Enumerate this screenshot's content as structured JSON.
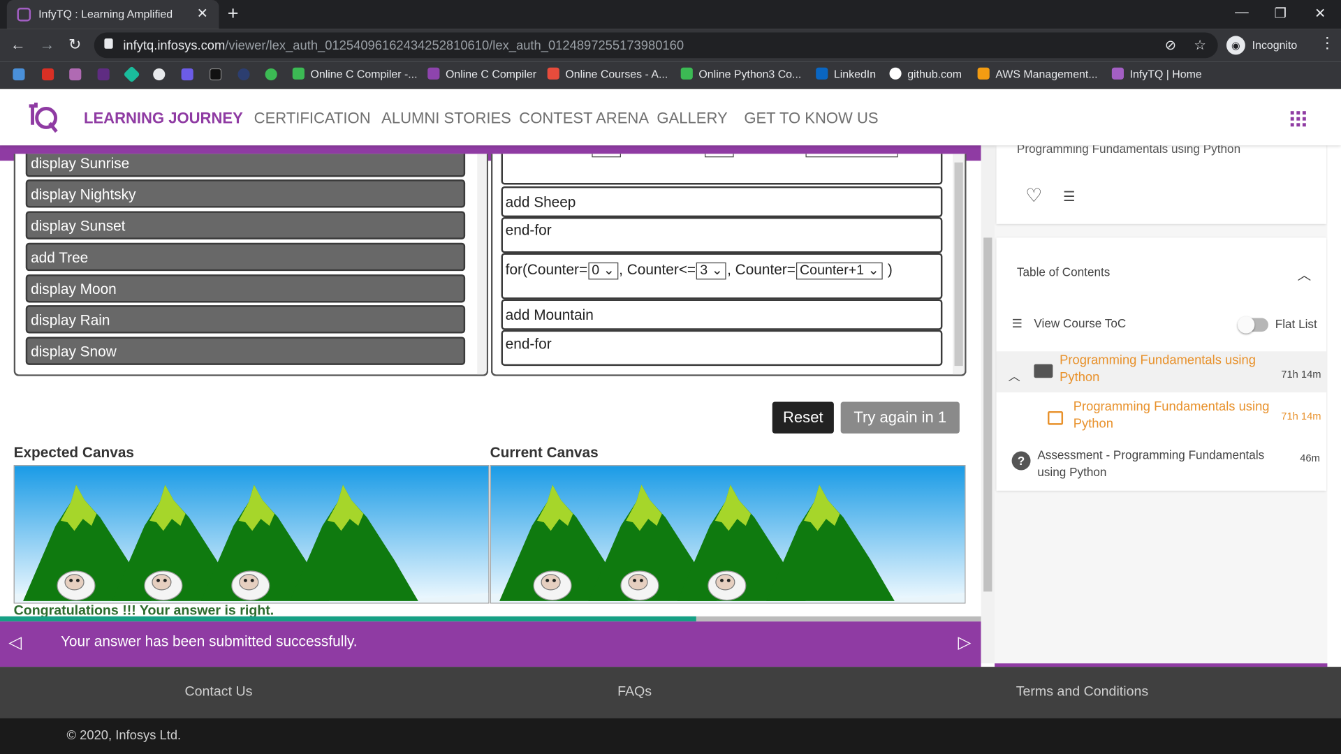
{
  "browser": {
    "tab_title": "InfyTQ : Learning Amplified",
    "tab_close": "✕",
    "new_tab": "+",
    "window_controls": {
      "minimize": "—",
      "restore": "❐",
      "close": "✕"
    },
    "nav": {
      "back": "←",
      "forward": "→",
      "reload": "↻"
    },
    "url_host": "infytq.infosys.com",
    "url_path": "/viewer/lex_auth_01254096162434252810610/lex_auth_0124897255173980160",
    "profile_label": "Incognito",
    "menu": "⋮",
    "omnibox_icons": {
      "eye_off": "⊘",
      "star": "☆"
    },
    "bookmarks": [
      {
        "label": "Online C Compiler -...",
        "color": "#3cba54"
      },
      {
        "label": "Online C Compiler",
        "color": "#8e44ad"
      },
      {
        "label": "Online Courses - A...",
        "color": "#e74c3c"
      },
      {
        "label": "Online Python3 Co...",
        "color": "#3cba54"
      },
      {
        "label": "LinkedIn",
        "color": "#0a66c2"
      },
      {
        "label": "github.com",
        "color": "#ffffff"
      },
      {
        "label": "AWS Management...",
        "color": "#f39c12"
      },
      {
        "label": "InfyTQ | Home",
        "color": "#a35fc4"
      }
    ]
  },
  "header": {
    "nav": [
      {
        "label": "LEARNING JOURNEY",
        "active": true
      },
      {
        "label": "CERTIFICATION",
        "active": false
      },
      {
        "label": "ALUMNI STORIES",
        "active": false
      },
      {
        "label": "CONTEST ARENA",
        "active": false
      },
      {
        "label": "GALLERY",
        "active": false
      },
      {
        "label": "GET TO KNOW US",
        "active": false
      }
    ]
  },
  "commands": [
    "display Sunrise",
    "display Nightsky",
    "display Sunset",
    "add Tree",
    "display Moon",
    "display Rain",
    "display Snow"
  ],
  "code": {
    "line_add_sheep": "add Sheep",
    "line_endfor_1": "end-for",
    "for_prefix": "for(Counter=",
    "for_start": "0",
    "for_mid": ", Counter<=",
    "for_end": "3",
    "for_mid2": ", Counter=",
    "for_step": "Counter+1",
    "for_suffix": " )",
    "line_add_mountain": "add Mountain",
    "line_endfor_2": "end-for",
    "select_arrow": "⌄"
  },
  "buttons": {
    "reset": "Reset",
    "try_again": "Try again in 1"
  },
  "canvas": {
    "expected_title": "Expected Canvas",
    "current_title": "Current Canvas",
    "mountain_count": 4,
    "sheep_count": 3,
    "colors": {
      "sky_top": "#1a9be6",
      "sky_bottom": "#f4fbff",
      "mountain": "#0f7a0f",
      "snowcap": "#a6d62a"
    }
  },
  "feedback": {
    "congrats": "Congratulations !!! Your answer is right.",
    "progress_percent": 71,
    "banner_message": "Your answer has been submitted successfully.",
    "arrow_left": "◁",
    "arrow_right": "▷"
  },
  "sidebar": {
    "course_title": "Programming Fundamentals using Python",
    "toc_title": "Table of Contents",
    "view_toc": "View Course ToC",
    "flat_list": "Flat List",
    "toc_items": [
      {
        "title": "Programming Fundamentals using Python",
        "time": "71h 14m"
      },
      {
        "title": "Programming Fundamentals using Python",
        "time": "71h 14m"
      },
      {
        "title": "Assessment - Programming Fundamentals using Python",
        "time": "46m"
      }
    ]
  },
  "footer": {
    "links": [
      "Contact Us",
      "FAQs",
      "Terms and Conditions"
    ],
    "copyright": "© 2020, Infosys Ltd."
  },
  "colors": {
    "brand": "#8f3ba3",
    "accent_orange": "#e8912b"
  }
}
